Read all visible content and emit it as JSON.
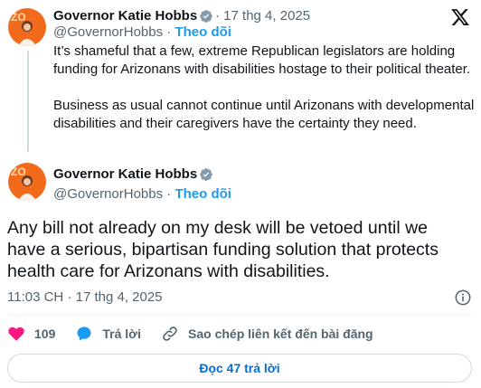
{
  "reply_tweet": {
    "author_name": "Governor Katie Hobbs",
    "date_text": "17 thg 4, 2025",
    "handle": "@GovernorHobbs",
    "follow_label": "Theo dõi",
    "paragraph_1": "It’s shameful that a few, extreme Republican legislators are holding funding for Arizonans with disabilities hostage to their political theater.",
    "paragraph_2": "Business as usual cannot continue until Arizonans with developmental disabilities and their caregivers have the certainty they need."
  },
  "main_tweet": {
    "author_name": "Governor Katie Hobbs",
    "handle": "@GovernorHobbs",
    "follow_label": "Theo dõi",
    "text": "Any bill not already on my desk will be vetoed until we have a serious, bipartisan funding solution that protects health care for Arizonans with disabilities.",
    "time": "11:03 CH",
    "date": "17 thg 4, 2025"
  },
  "actions": {
    "like_count": "109",
    "reply_label": "Trả lời",
    "copy_link_label": "Sao chép liên kết đến bài đăng"
  },
  "footer": {
    "read_replies_label": "Đọc 47 trả lời"
  },
  "icons": {
    "verified": "verified-badge-icon",
    "x_logo": "x-logo-icon",
    "info": "info-icon",
    "like": "heart-icon",
    "reply": "speech-bubble-icon",
    "link": "link-icon"
  },
  "colors": {
    "accent": "#1d9bf0",
    "like": "#f91880",
    "secondary_text": "#536471",
    "read_replies_text": "#006fd6"
  }
}
